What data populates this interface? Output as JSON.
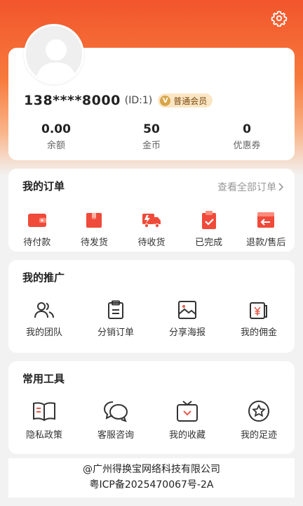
{
  "user": {
    "phone": "138****8000",
    "id_text": "(ID:1)",
    "vip_label": "普通会员"
  },
  "stats": [
    {
      "value": "0.00",
      "label": "余额"
    },
    {
      "value": "50",
      "label": "金币"
    },
    {
      "value": "0",
      "label": "优惠券"
    }
  ],
  "orders": {
    "title": "我的订单",
    "view_all": "查看全部订单",
    "items": [
      {
        "label": "待付款",
        "icon": "wallet-icon"
      },
      {
        "label": "待发货",
        "icon": "package-icon"
      },
      {
        "label": "待收货",
        "icon": "truck-icon"
      },
      {
        "label": "已完成",
        "icon": "clipboard-check-icon"
      },
      {
        "label": "退款/售后",
        "icon": "refund-icon"
      }
    ]
  },
  "promotion": {
    "title": "我的推广",
    "items": [
      {
        "label": "我的团队",
        "icon": "team-icon"
      },
      {
        "label": "分销订单",
        "icon": "order-list-icon"
      },
      {
        "label": "分享海报",
        "icon": "poster-icon"
      },
      {
        "label": "我的佣金",
        "icon": "commission-icon"
      }
    ]
  },
  "tools": {
    "title": "常用工具",
    "items": [
      {
        "label": "隐私政策",
        "icon": "book-icon"
      },
      {
        "label": "客服咨询",
        "icon": "chat-icon"
      },
      {
        "label": "我的收藏",
        "icon": "favorites-icon"
      },
      {
        "label": "我的足迹",
        "icon": "footprint-star-icon"
      }
    ]
  },
  "footer": {
    "company": "@广州得换宝网络科技有限公司",
    "icp": "粤ICP备2025470067号-2A"
  },
  "colors": {
    "accent": "#f2552c",
    "order_icon": "#f04a3a"
  }
}
